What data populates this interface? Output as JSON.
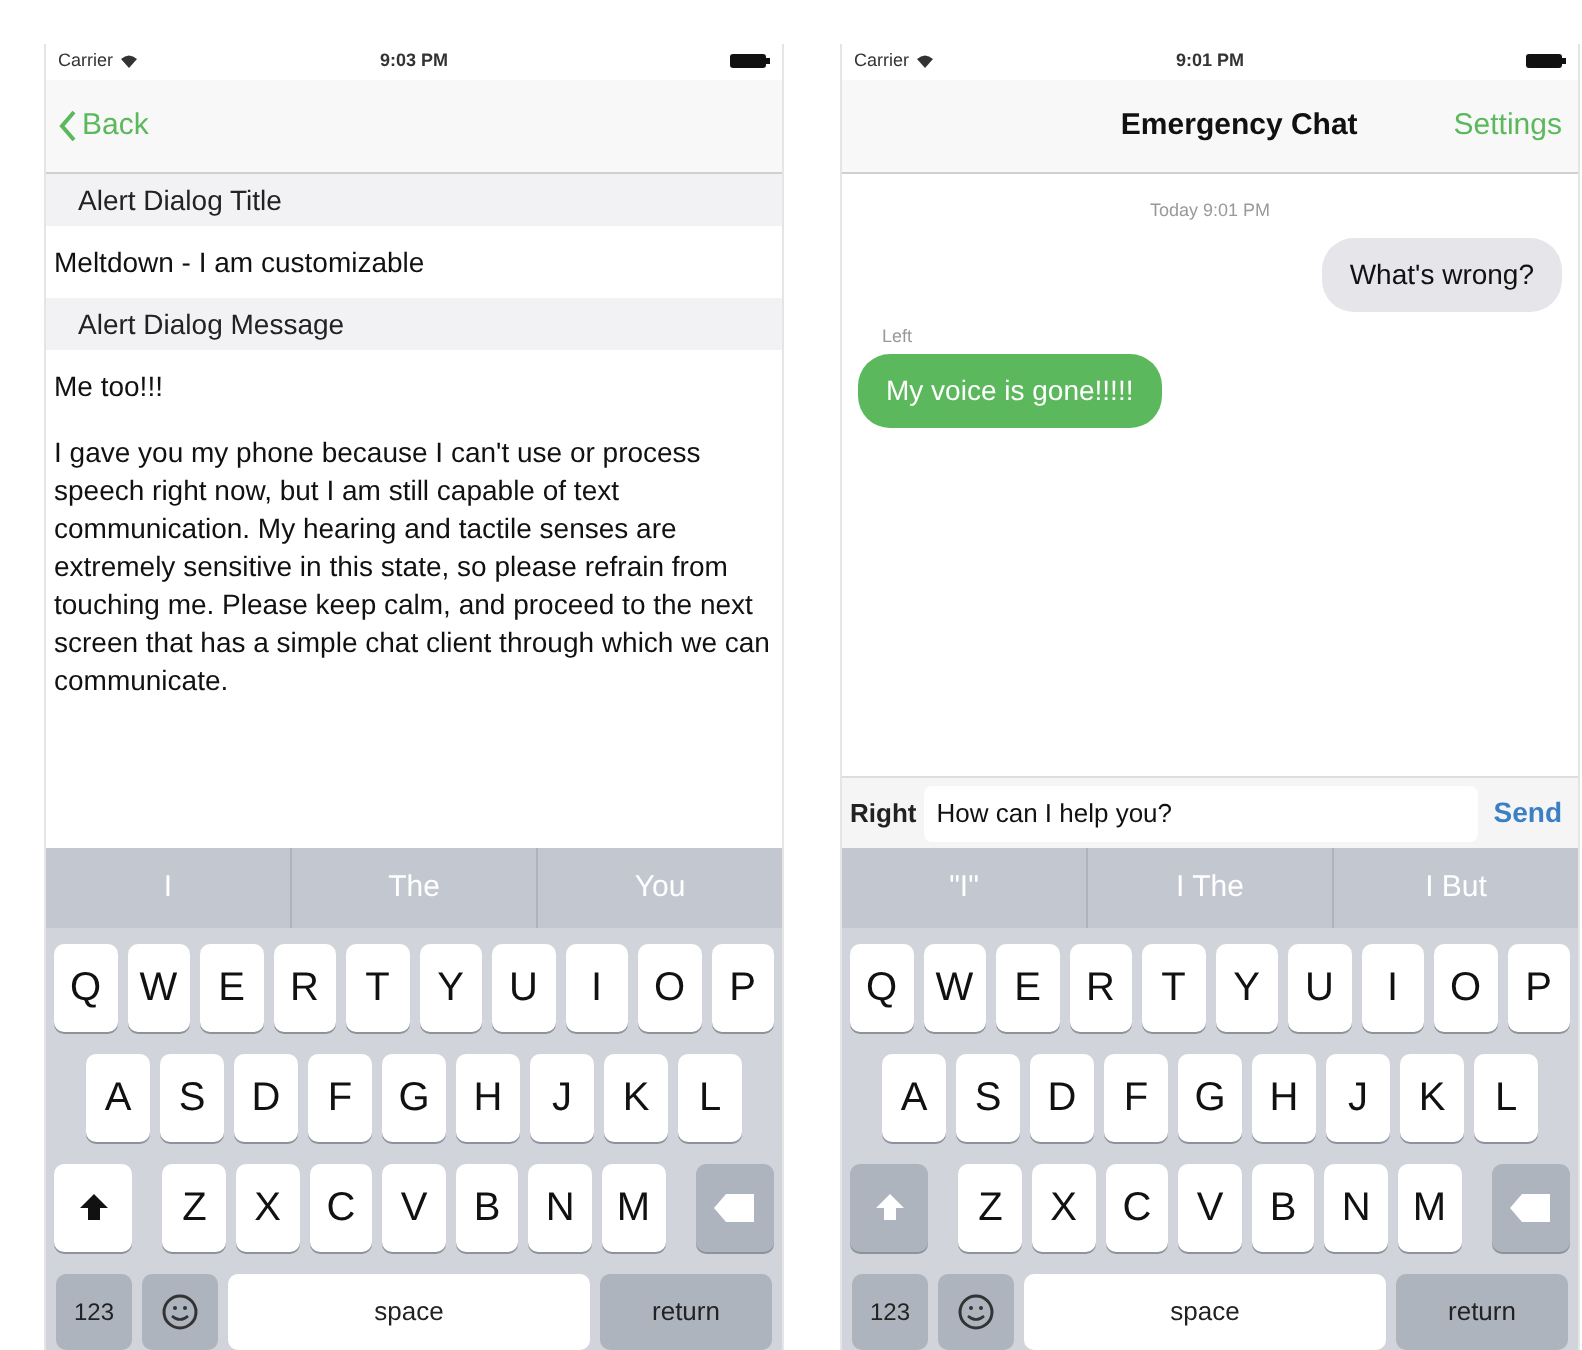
{
  "left_phone": {
    "status_bar": {
      "carrier": "Carrier",
      "time": "9:03 PM"
    },
    "nav": {
      "back": "Back"
    },
    "form": [
      {
        "kind": "header",
        "text": "Alert Dialog Title"
      },
      {
        "kind": "value",
        "text": "Meltdown - I am customizable"
      },
      {
        "kind": "header",
        "text": "Alert Dialog Message"
      },
      {
        "kind": "value",
        "text": "Me too!!!"
      },
      {
        "kind": "paragraph",
        "text": "I gave you my phone because I can't use or process speech right now, but I am still capable of text communication. My hearing and tactile senses are extremely sensitive in this state, so please refrain from touching me. Please keep calm, and proceed to the next screen that has a simple chat client through which we can communicate."
      }
    ],
    "keyboard": {
      "suggestions": [
        "I",
        "The",
        "You"
      ],
      "shift_on": true,
      "rows": [
        [
          "Q",
          "W",
          "E",
          "R",
          "T",
          "Y",
          "U",
          "I",
          "O",
          "P"
        ],
        [
          "A",
          "S",
          "D",
          "F",
          "G",
          "H",
          "J",
          "K",
          "L"
        ],
        [
          "Z",
          "X",
          "C",
          "V",
          "B",
          "N",
          "M"
        ]
      ],
      "numbers_key": "123",
      "space_key": "space",
      "return_key": "return"
    }
  },
  "right_phone": {
    "status_bar": {
      "carrier": "Carrier",
      "time": "9:01 PM"
    },
    "nav": {
      "title": "Emergency Chat",
      "action": "Settings"
    },
    "chat": {
      "timestamp": "Today 9:01 PM",
      "messages": [
        {
          "kind": "outgoing",
          "text": "What's wrong?"
        },
        {
          "kind": "incoming",
          "sender": "Left",
          "text": "My voice is gone!!!!!"
        }
      ]
    },
    "composer": {
      "sender": "Right",
      "value": "How can I help you?",
      "send": "Send"
    },
    "keyboard": {
      "suggestions": [
        "\"I\"",
        "I The",
        "I But"
      ],
      "shift_on": false,
      "rows": [
        [
          "Q",
          "W",
          "E",
          "R",
          "T",
          "Y",
          "U",
          "I",
          "O",
          "P"
        ],
        [
          "A",
          "S",
          "D",
          "F",
          "G",
          "H",
          "J",
          "K",
          "L"
        ],
        [
          "Z",
          "X",
          "C",
          "V",
          "B",
          "N",
          "M"
        ]
      ],
      "numbers_key": "123",
      "space_key": "space",
      "return_key": "return"
    }
  }
}
